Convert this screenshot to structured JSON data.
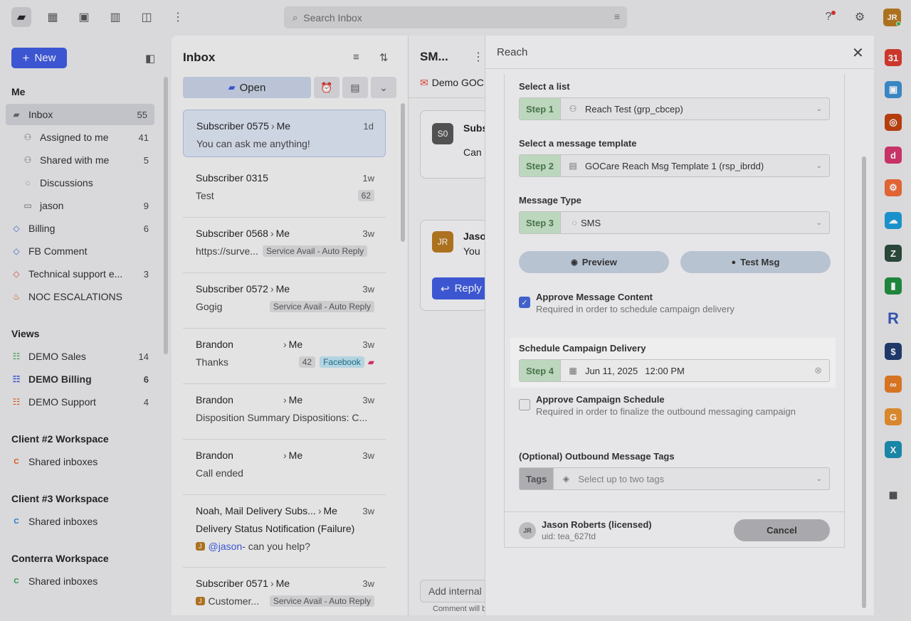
{
  "search": {
    "placeholder": "Search Inbox"
  },
  "user": {
    "initials": "JR"
  },
  "sidebar": {
    "new_label": "New",
    "me_title": "Me",
    "items": [
      {
        "label": "Inbox",
        "count": "55"
      },
      {
        "label": "Assigned to me",
        "count": "41"
      },
      {
        "label": "Shared with me",
        "count": "5"
      },
      {
        "label": "Discussions",
        "count": ""
      },
      {
        "label": "jason",
        "count": "9"
      },
      {
        "label": "Billing",
        "count": "6"
      },
      {
        "label": "FB Comment",
        "count": ""
      },
      {
        "label": "Technical support e...",
        "count": "3"
      },
      {
        "label": "NOC ESCALATIONS",
        "count": ""
      }
    ],
    "views_title": "Views",
    "views": [
      {
        "label": "DEMO Sales",
        "count": "14"
      },
      {
        "label": "DEMO Billing",
        "count": "6"
      },
      {
        "label": "DEMO Support",
        "count": "4"
      }
    ],
    "workspaces": [
      {
        "title": "Client #2 Workspace",
        "item": "Shared inboxes",
        "badge": "C"
      },
      {
        "title": "Client #3 Workspace",
        "item": "Shared inboxes",
        "badge": "C"
      },
      {
        "title": "Conterra Workspace",
        "item": "Shared inboxes",
        "badge": "C"
      }
    ]
  },
  "inbox": {
    "title": "Inbox",
    "open_label": "Open",
    "messages": [
      {
        "from": "Subscriber 0575",
        "to": "Me",
        "time": "1d",
        "preview": "You can ask me anything!"
      },
      {
        "from": "Subscriber 0315",
        "to": "",
        "time": "1w",
        "preview": "Test",
        "count": "62"
      },
      {
        "from": "Subscriber 0568",
        "to": "Me",
        "time": "3w",
        "preview": "https://surve...",
        "tag": "Service Avail - Auto Reply"
      },
      {
        "from": "Subscriber 0572",
        "to": "Me",
        "time": "3w",
        "preview": "Gogig",
        "tag": "Service Avail - Auto Reply"
      },
      {
        "from": "Brandon",
        "to": "Me",
        "time": "3w",
        "preview": "Thanks",
        "count": "42",
        "tag": "Facebook"
      },
      {
        "from": "Brandon",
        "to": "Me",
        "time": "3w",
        "preview": "Disposition Summary Dispositions: C..."
      },
      {
        "from": "Brandon",
        "to": "Me",
        "time": "3w",
        "preview": "Call ended"
      },
      {
        "from": "Noah, Mail Delivery Subs...",
        "to": "Me",
        "time": "3w",
        "preview": "Delivery Status Notification (Failure)",
        "preview2_mention": "@jason",
        "preview2": " - can you help?",
        "badge": "J"
      },
      {
        "from": "Subscriber 0571",
        "to": "Me",
        "time": "3w",
        "preview": "Customer...",
        "tag": "Service Avail - Auto Reply",
        "badge": "J"
      }
    ]
  },
  "conversation": {
    "title": "SM...",
    "inbox_tag": "Demo GOC...",
    "card1_avatar": "S0",
    "card1_name": "Subs",
    "card1_text": "Can",
    "card2_avatar": "JR",
    "card2_name": "Jaso",
    "card2_text": "You",
    "reply_label": "Reply",
    "internal_placeholder": "Add internal",
    "footer_note": "Comment will b"
  },
  "reach": {
    "title": "Reach",
    "list_label": "Select a list",
    "list_step": "Step 1",
    "list_value": "Reach Test (grp_cbcep)",
    "template_label": "Select a message template",
    "template_step": "Step 2",
    "template_value": "GOCare Reach Msg Template 1 (rsp_ibrdd)",
    "type_label": "Message Type",
    "type_step": "Step 3",
    "type_value": "SMS",
    "preview_label": "Preview",
    "test_label": "Test Msg",
    "approve_content_title": "Approve Message Content",
    "approve_content_sub": "Required in order to schedule campaign delivery",
    "approve_content_checked": true,
    "schedule_label": "Schedule Campaign Delivery",
    "schedule_step": "Step 4",
    "schedule_date": "Jun 11, 2025",
    "schedule_time": "12:00 PM",
    "approve_schedule_title": "Approve Campaign Schedule",
    "approve_schedule_sub": "Required in order to finalize the outbound messaging campaign",
    "approve_schedule_checked": false,
    "tags_label": "(Optional) Outbound Message Tags",
    "tags_step": "Tags",
    "tags_placeholder": "Select up to two tags",
    "footer_initials": "JR",
    "footer_name": "Jason Roberts (licensed)",
    "footer_uid": "uid: tea_627td",
    "cancel_label": "Cancel"
  },
  "rail": [
    {
      "name": "calendar-icon",
      "text": "31",
      "color": "#d93a2b"
    },
    {
      "name": "contacts-icon",
      "text": "▣",
      "color": "#3c8fd0"
    },
    {
      "name": "target-icon",
      "text": "◎",
      "color": "#c2410c"
    },
    {
      "name": "app-icon",
      "text": "d",
      "color": "#d6336c"
    },
    {
      "name": "hubspot-icon",
      "text": "⚙",
      "color": "#f06a35"
    },
    {
      "name": "salesforce-icon",
      "text": "☁",
      "color": "#1a9bd7"
    },
    {
      "name": "zendesk-icon",
      "text": "Z",
      "color": "#2b4a3a"
    },
    {
      "name": "book-icon",
      "text": "▮",
      "color": "#1e8e3e"
    },
    {
      "name": "reach-icon",
      "text": "R",
      "color": "#3558b8"
    },
    {
      "name": "dollar-icon",
      "text": "$",
      "color": "#1f3a6e"
    },
    {
      "name": "dots-icon",
      "text": "∞",
      "color": "#e57b22"
    },
    {
      "name": "g-icon",
      "text": "G",
      "color": "#e8902c"
    },
    {
      "name": "x-icon",
      "text": "X",
      "color": "#1a8fb0"
    },
    {
      "name": "apps-grid-icon",
      "text": "▦",
      "color": "#444"
    }
  ]
}
